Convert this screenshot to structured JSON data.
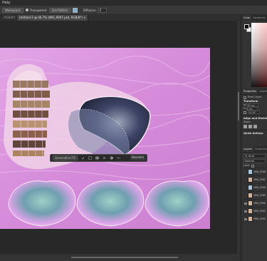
{
  "menubar": {
    "help_label": "Help"
  },
  "options": {
    "workspace_button": "Workspace",
    "transparent_label": "Transparent",
    "transparent_checked": true,
    "use_pattern_label": "Use Pattern",
    "use_pattern_checked": false,
    "swatch_color": "#7fb2d6",
    "diffusion_label": "Diffusion:",
    "diffusion_value": "0"
  },
  "tabs": [
    {
      "label": ", RGB/8*) ×",
      "active": false
    },
    {
      "label": "Untitled-2 @ 66.7% (IMG_9907.psd, RGB/8*) ×",
      "active": true
    }
  ],
  "context_bar": {
    "generative_fill": "Generative Fill",
    "deselect": "Deselect"
  },
  "right_panel": {
    "color_tabs": [
      "Color",
      "Swatches"
    ],
    "properties_tabs": [
      "Properties",
      "Adjustments"
    ],
    "pixel_layer_label": "Pixel Layer",
    "transform_label": "Transform",
    "w_label": "W",
    "w_value": "37 px",
    "h_label": "H",
    "h_value": "0 px",
    "angle_value": "0.00°",
    "align_label": "Align and Distribute",
    "align_sub": "Align:",
    "quick_actions_label": "Quick Actions",
    "layers_tabs": [
      "Layers",
      "Channels"
    ],
    "search_label": "Kind",
    "blend_mode": "Normal",
    "lock_label": "Lock:",
    "layers": [
      {
        "name": "IMG_9908",
        "visible": false,
        "alt": true
      },
      {
        "name": "IMG_9907",
        "visible": false,
        "alt": false
      },
      {
        "name": "IMG_9906",
        "visible": false,
        "alt": true
      },
      {
        "name": "IMG_9905",
        "visible": false,
        "alt": false
      },
      {
        "name": "IMG_9904",
        "visible": true,
        "alt": false
      },
      {
        "name": "IMG_9903",
        "visible": true,
        "alt": false
      },
      {
        "name": "IMG_9902",
        "visible": true,
        "alt": false
      }
    ]
  }
}
